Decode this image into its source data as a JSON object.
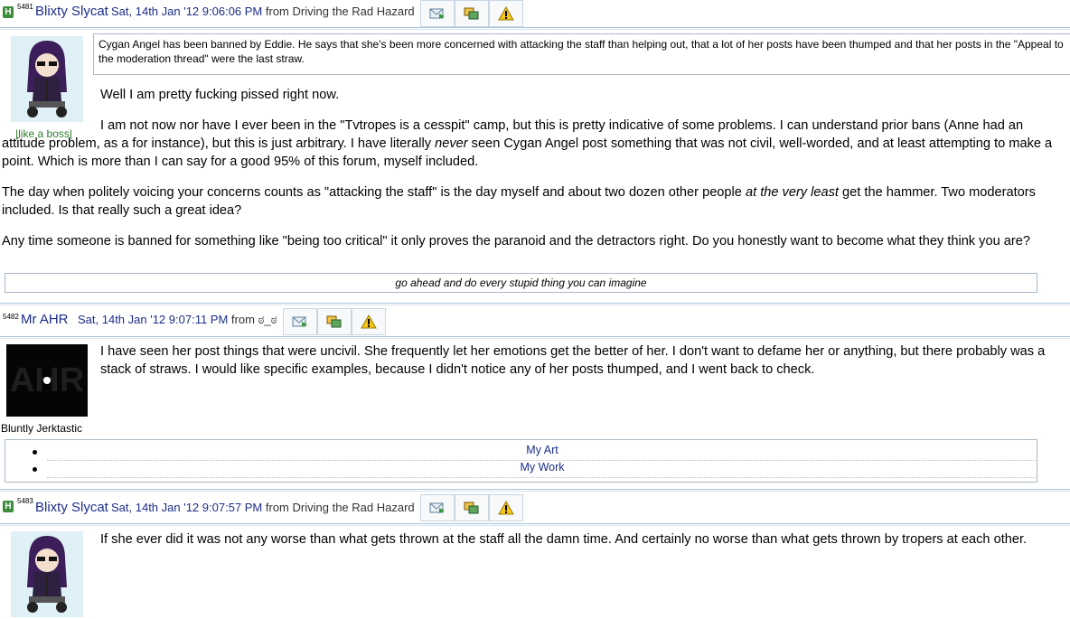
{
  "posts": [
    {
      "post_number": "5481",
      "author": "Blixty Slycat",
      "date": "Sat, 14th Jan '12 9:06:06 PM",
      "from_label": "from",
      "location": "Driving the Rad Hazard",
      "badge": "H",
      "user_title": "|like a boss|",
      "notice": "Cygan Angel has been banned by Eddie. He says that she's been more concerned with attacking the staff than helping out, that a lot of her posts have been thumped and that her posts in the \"Appeal to the moderation thread\" were the last straw.",
      "paragraphs": {
        "p1": "Well I am pretty fucking pissed right now.",
        "p2a": "I am not now nor have I ever been in the \"Tvtropes is a cesspit\" camp, but this is pretty indicative of some problems. I can understand prior bans (Anne had an attitude problem, as a for instance), but this is just arbitrary. I have literally ",
        "p2em": "never",
        "p2b": " seen Cygan Angel post something that was not civil, well-worded, and at least attempting to make a point. Which is more than I can say for a good 95% of this forum, myself included.",
        "p3a": "The day when politely voicing your concerns counts as \"attacking the staff\" is the day myself and about two dozen other people ",
        "p3em": "at the very least",
        "p3b": " get the hammer. Two moderators included. Is that really such a great idea?",
        "p4": "Any time someone is banned for something like \"being too critical\" it only proves the paranoid and the detractors right. Do you honestly want to become what they think you are?"
      },
      "signature": "go ahead and do every stupid thing you can imagine"
    },
    {
      "post_number": "5482",
      "author": "Mr AHR",
      "date": "Sat, 14th Jan '12 9:07:11 PM",
      "from_label": "from",
      "location": "ಠ_ಠ",
      "user_title": "Bluntly Jerktastic",
      "avatar_text": "AHR",
      "paragraph": "I have seen her post things that were uncivil. She frequently let her emotions get the better of her. I don't want to defame her or anything, but there probably was a stack of straws. I would like specific examples, because I didn't notice any of her posts thumped, and I went back to check.",
      "links": [
        "My Art",
        "My Work"
      ]
    },
    {
      "post_number": "5483",
      "author": "Blixty Slycat",
      "date": "Sat, 14th Jan '12 9:07:57 PM",
      "from_label": "from",
      "location": "Driving the Rad Hazard",
      "badge": "H",
      "paragraph": "If she ever did it was not any worse than what gets thrown at the staff all the damn time. And certainly no worse than what gets thrown by tropers at each other."
    }
  ],
  "buttons": {
    "message_icon": "pm-envelope-icon",
    "quote_icon": "quote-icon",
    "report_icon": "warning-icon"
  },
  "colors": {
    "link": "#1c2e8a",
    "badge": "#3b8c3b",
    "title_green": "#2e7d2e",
    "border": "#aab8c6"
  }
}
